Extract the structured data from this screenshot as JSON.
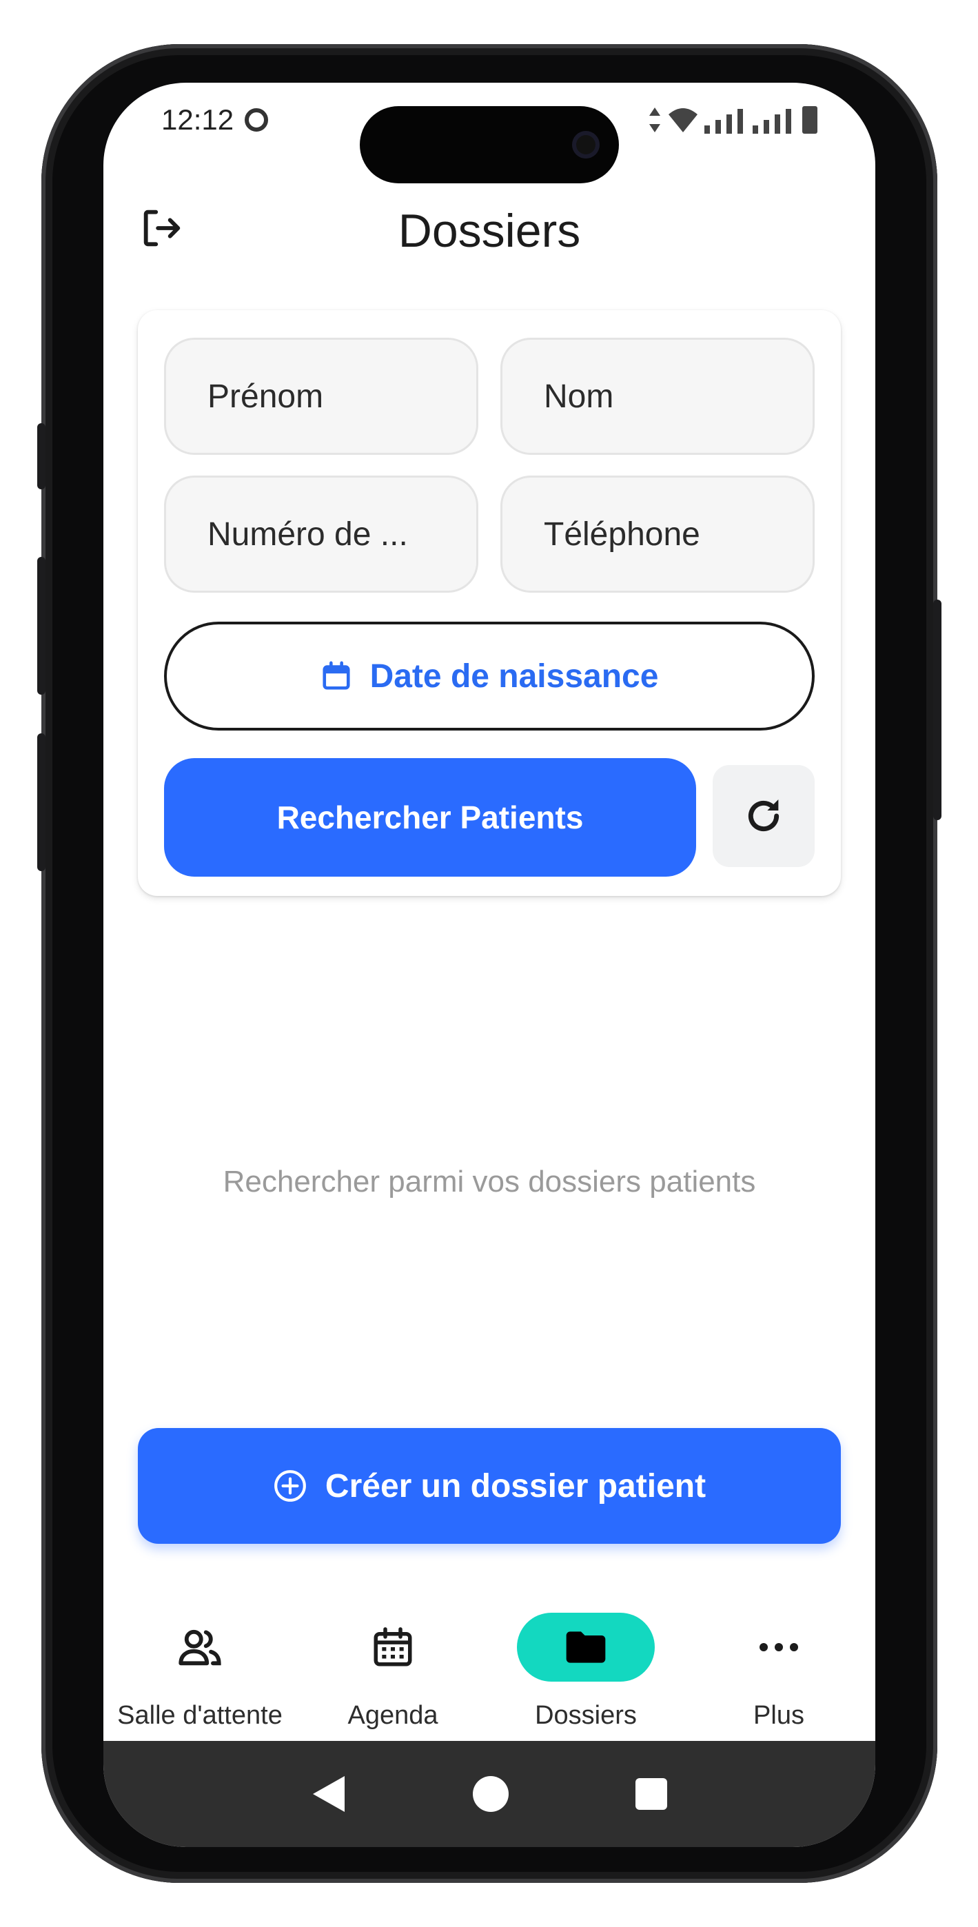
{
  "status_bar": {
    "time": "12:12"
  },
  "app_bar": {
    "title": "Dossiers"
  },
  "search_form": {
    "first_name_placeholder": "Prénom",
    "last_name_placeholder": "Nom",
    "number_placeholder": "Numéro de ...",
    "phone_placeholder": "Téléphone",
    "birthdate_label": "Date de naissance",
    "search_label": "Rechercher Patients"
  },
  "empty_state": {
    "hint": "Rechercher parmi vos dossiers patients"
  },
  "create_button": {
    "label": "Créer un dossier patient"
  },
  "bottom_nav": {
    "items": [
      {
        "label": "Salle d'attente",
        "icon": "people-icon"
      },
      {
        "label": "Agenda",
        "icon": "calendar-icon"
      },
      {
        "label": "Dossiers",
        "icon": "folder-icon",
        "active": true
      },
      {
        "label": "Plus",
        "icon": "more-horiz-icon"
      }
    ]
  },
  "colors": {
    "primary": "#2a6bff",
    "active_nav": "#13d8c0",
    "hint_text": "#9a9a9a"
  }
}
